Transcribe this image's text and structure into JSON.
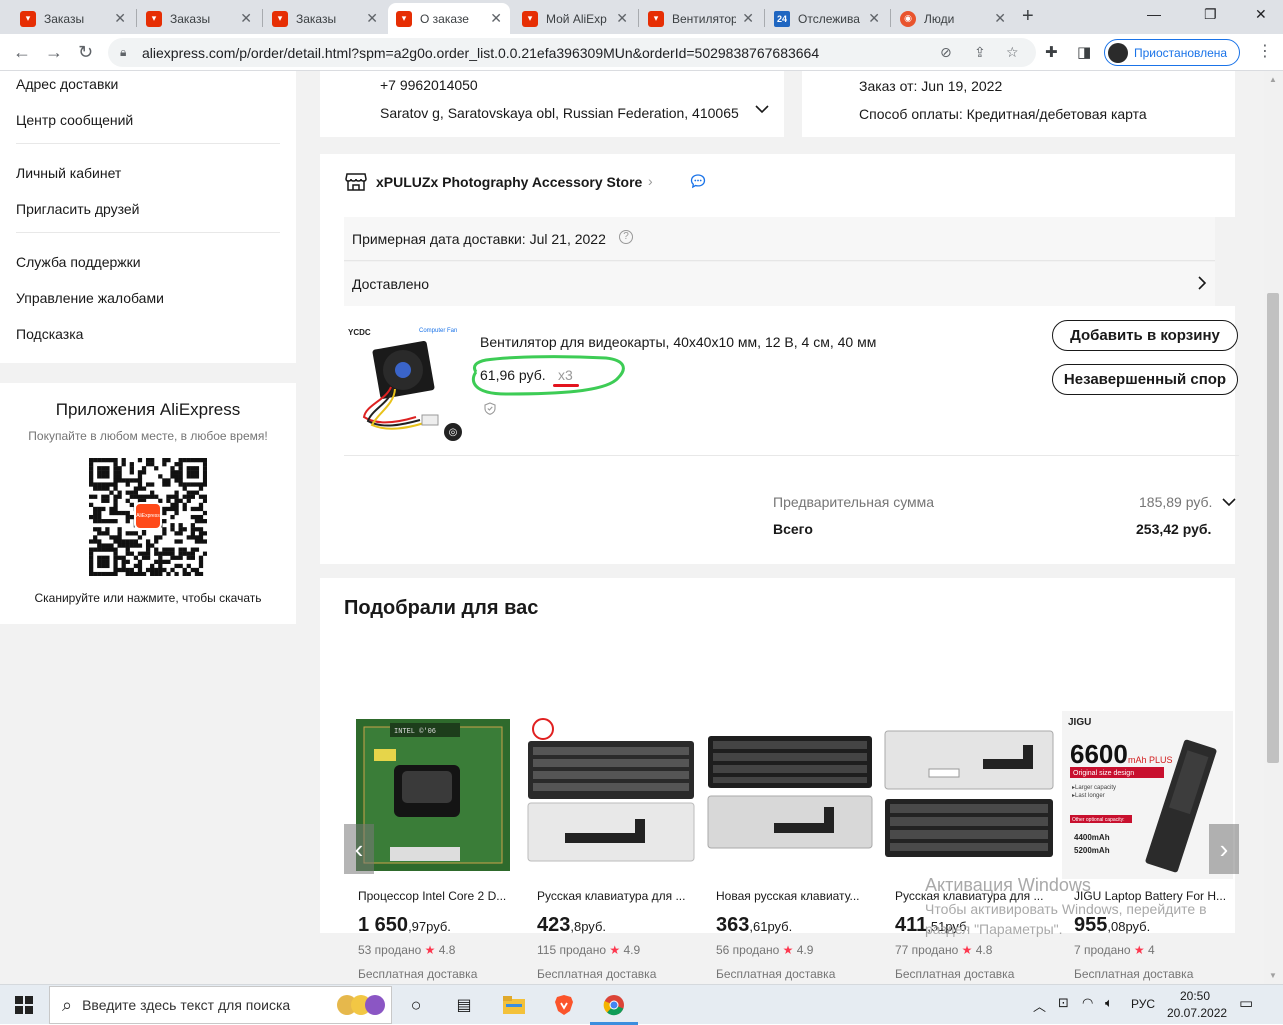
{
  "browser": {
    "tabs": [
      {
        "title": "Заказы",
        "favicon": "aliexpress-icon",
        "color": "#e62e04"
      },
      {
        "title": "Заказы",
        "favicon": "aliexpress-icon",
        "color": "#e62e04"
      },
      {
        "title": "Заказы",
        "favicon": "aliexpress-icon",
        "color": "#e62e04"
      },
      {
        "title": "О заказе",
        "favicon": "aliexpress-icon",
        "color": "#e62e04",
        "active": true
      },
      {
        "title": "Мой AliExp",
        "favicon": "aliexpress-icon",
        "color": "#e62e04"
      },
      {
        "title": "Вентилятор",
        "favicon": "aliexpress-icon",
        "color": "#e62e04"
      },
      {
        "title": "Отслежива",
        "favicon": "tracking-24-icon",
        "color": "#1f66c1"
      },
      {
        "title": "Люди",
        "favicon": "people-icon",
        "color": "#e9542d"
      }
    ],
    "tab_24_badge": "24",
    "url": "aliexpress.com/p/order/detail.html?spm=a2g0o.order_list.0.0.21efa396309MUn&orderId=5029838767683664",
    "profile_label": "Приостановлена"
  },
  "sidebar": {
    "items": [
      "Адрес доставки",
      "Центр сообщений",
      "Личный кабинет",
      "Пригласить друзей",
      "Служба поддержки",
      "Управление жалобами",
      "Подсказка"
    ],
    "apps_title": "Приложения AliExpress",
    "apps_subtitle": "Покупайте в любом месте, в любое время!",
    "apps_download": "Сканируйте или нажмите, чтобы скачать",
    "qr_logo_text": "AliExpress"
  },
  "address": {
    "phone": "+7 9962014050",
    "location": "Saratov g, Saratovskaya obl, Russian Federation, 410065"
  },
  "order_info": {
    "date": "Заказ от: Jun 19, 2022",
    "payment": "Способ оплаты: Кредитная/дебетовая карта"
  },
  "store": {
    "name": "xPULUZx Photography Accessory Store"
  },
  "delivery": {
    "estimate": "Примерная дата доставки: Jul 21, 2022",
    "status": "Доставлено"
  },
  "item": {
    "title": "Вентилятор для видеокарты, 40x40x10 мм, 12 В, 4 см, 40 мм",
    "price": "61,96 руб.",
    "qty": "x3",
    "image_brand": "YCDC",
    "image_label": "Computer Fan",
    "add_to_cart": "Добавить в корзину",
    "dispute": "Незавершенный спор"
  },
  "summary": {
    "subtotal_label": "Предварительная сумма",
    "subtotal_value": "185,89 руб.",
    "total_label": "Всего",
    "total_value": "253,42 руб."
  },
  "recommendations": {
    "title": "Подобрали для вас",
    "products": [
      {
        "title": "Процессор Intel Core 2 D...",
        "price_main": "1 650",
        "price_rest": ",97руб.",
        "sold": "53 продано",
        "rating": "4.8",
        "shipping": "Бесплатная доставка",
        "img_text": "INTEL ©'06"
      },
      {
        "title": "Русская клавиатура для ...",
        "price_main": "423",
        "price_rest": ",8руб.",
        "sold": "115 продано",
        "rating": "4.9",
        "shipping": "Бесплатная доставка"
      },
      {
        "title": "Новая русская клавиату...",
        "price_main": "363",
        "price_rest": ",61руб.",
        "sold": "56 продано",
        "rating": "4.9",
        "shipping": "Бесплатная доставка"
      },
      {
        "title": "Русская клавиатура для ...",
        "price_main": "411",
        "price_rest": ",51руб.",
        "sold": "77 продано",
        "rating": "4.8",
        "shipping": "Бесплатная доставка"
      },
      {
        "title": "JIGU Laptop Battery For H...",
        "price_main": "955",
        "price_rest": ",08руб.",
        "sold": "7 продано",
        "rating": "4",
        "shipping": "Бесплатная доставка",
        "img_brand": "JIGU",
        "img_big": "6600",
        "img_unit": "mAh PLUS",
        "img_tag": "Original size design",
        "img_line1": "▸Larger capacity",
        "img_line2": "▸Last longer",
        "img_opt": "Other optional capacity:",
        "img_opt1": "4400mAh",
        "img_opt2": "5200mAh"
      }
    ]
  },
  "watermark": {
    "line1": "Активация Windows",
    "line2": "Чтобы активировать Windows, перейдите в",
    "line3": "раздел \"Параметры\"."
  },
  "taskbar": {
    "search_placeholder": "Введите здесь текст для поиска",
    "lang": "РУС",
    "time": "20:50",
    "date": "20.07.2022"
  },
  "colors": {
    "accent": "#fd384f",
    "green_highlight": "#3dcc55",
    "red_underline": "#e3141e",
    "chat_blue": "#1a73e8"
  }
}
